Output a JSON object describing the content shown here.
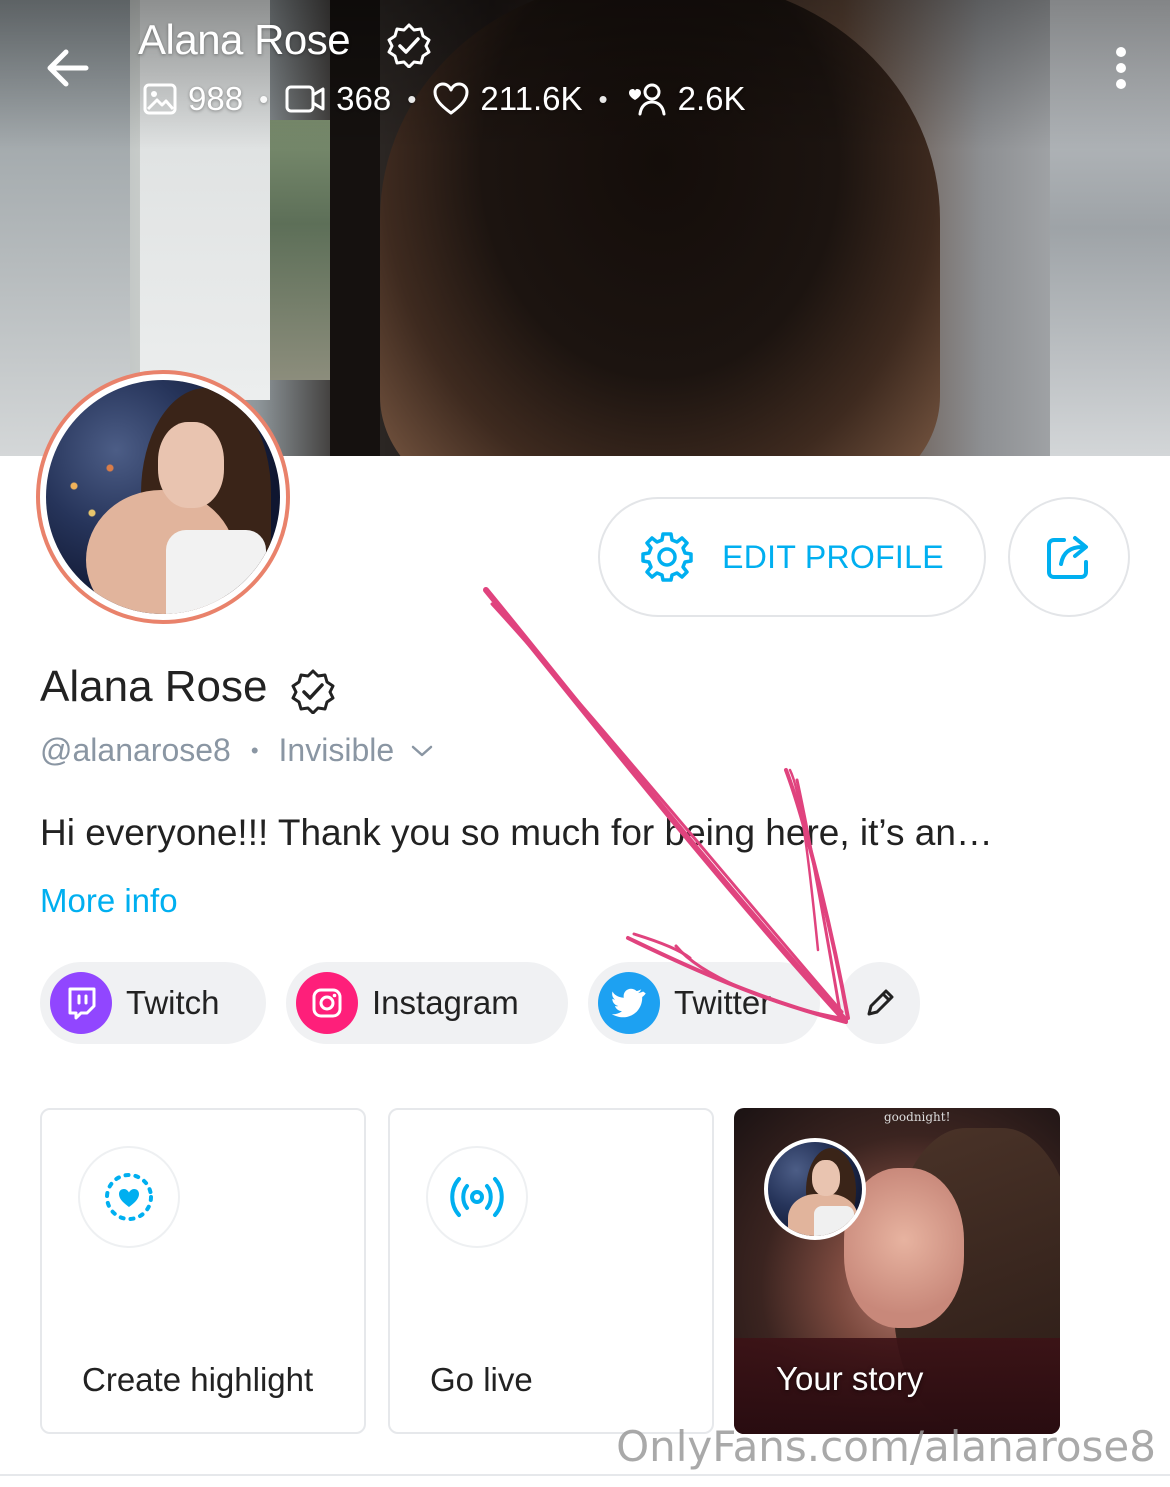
{
  "header": {
    "title": "Alana Rose",
    "stats": {
      "photos": "988",
      "videos": "368",
      "likes": "211.6K",
      "fans": "2.6K"
    }
  },
  "profile": {
    "edit_label": "EDIT PROFILE",
    "name": "Alana Rose",
    "handle": "@alanarose8",
    "status": "Invisible",
    "bio": "Hi everyone!!! Thank you so much for being here, it’s an…",
    "more_info": "More info"
  },
  "socials": [
    {
      "label": "Twitch",
      "color": "#9146ff"
    },
    {
      "label": "Instagram",
      "color": "#fe1f7a"
    },
    {
      "label": "Twitter",
      "color": "#1da1f2"
    }
  ],
  "cards": {
    "highlight": "Create highlight",
    "live": "Go live",
    "story": "Your story",
    "story_caption": "goodnight!"
  },
  "watermark": "OnlyFans.com/alanarose8",
  "colors": {
    "accent": "#00aff0",
    "avatar_ring": "#e9826b",
    "annotation_arrow": "#e0437e"
  },
  "icons": [
    "back-arrow-icon",
    "verified-icon",
    "image-icon",
    "video-icon",
    "heart-icon",
    "fans-icon",
    "more-vertical-icon",
    "gear-icon",
    "share-icon",
    "chevron-down-icon",
    "twitch-icon",
    "instagram-icon",
    "twitter-icon",
    "pencil-icon",
    "highlight-heart-icon",
    "broadcast-icon"
  ]
}
